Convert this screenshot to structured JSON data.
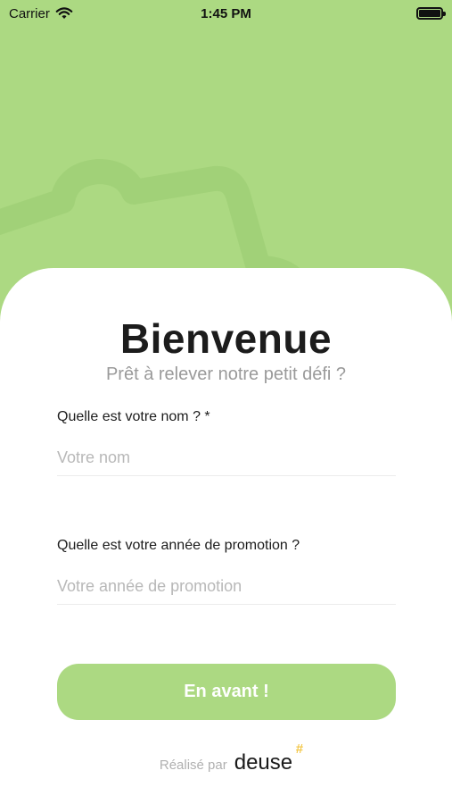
{
  "status_bar": {
    "carrier": "Carrier",
    "time": "1:45 PM"
  },
  "header": {
    "title": "Bienvenue",
    "subtitle": "Prêt à relever notre petit défi ?"
  },
  "form": {
    "name": {
      "label": "Quelle est votre nom ? *",
      "placeholder": "Votre nom",
      "value": ""
    },
    "promotion": {
      "label": "Quelle est votre année de promotion ?",
      "placeholder": "Votre année de promotion",
      "value": ""
    },
    "submit_label": "En avant !"
  },
  "footer": {
    "made_by": "Réalisé par",
    "brand": "deuse",
    "brand_mark": "#"
  },
  "colors": {
    "accent": "#acd982",
    "brand_mark": "#f3c84b"
  }
}
